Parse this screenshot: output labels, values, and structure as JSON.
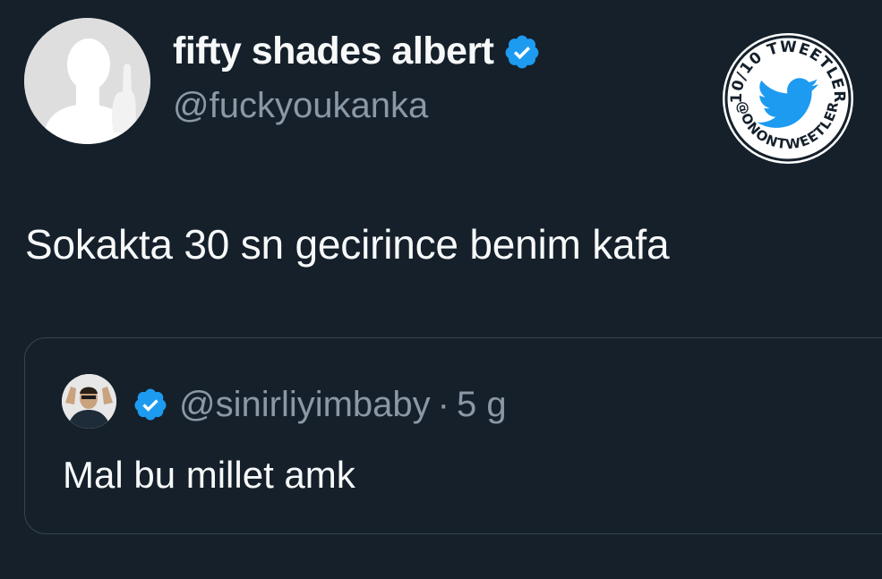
{
  "tweet": {
    "author": {
      "display_name": "fifty shades albert",
      "handle": "@fuckyoukanka",
      "verified": true
    },
    "text": "Sokakta 30 sn gecirince benim kafa"
  },
  "badge": {
    "top_text": "10/10 TWEETLER",
    "bottom_text": "@ONONTWEETLER",
    "icon": "bird-icon"
  },
  "quoted_tweet": {
    "handle": "@sinirliyimbaby",
    "separator": "·",
    "time": "5 g",
    "verified": true,
    "text": "Mal bu millet amk"
  },
  "colors": {
    "background": "#15202b",
    "primary_text": "#f7f9f9",
    "secondary_text": "#8b98a5",
    "verified_blue": "#1d9bf0",
    "border": "#38444d"
  }
}
